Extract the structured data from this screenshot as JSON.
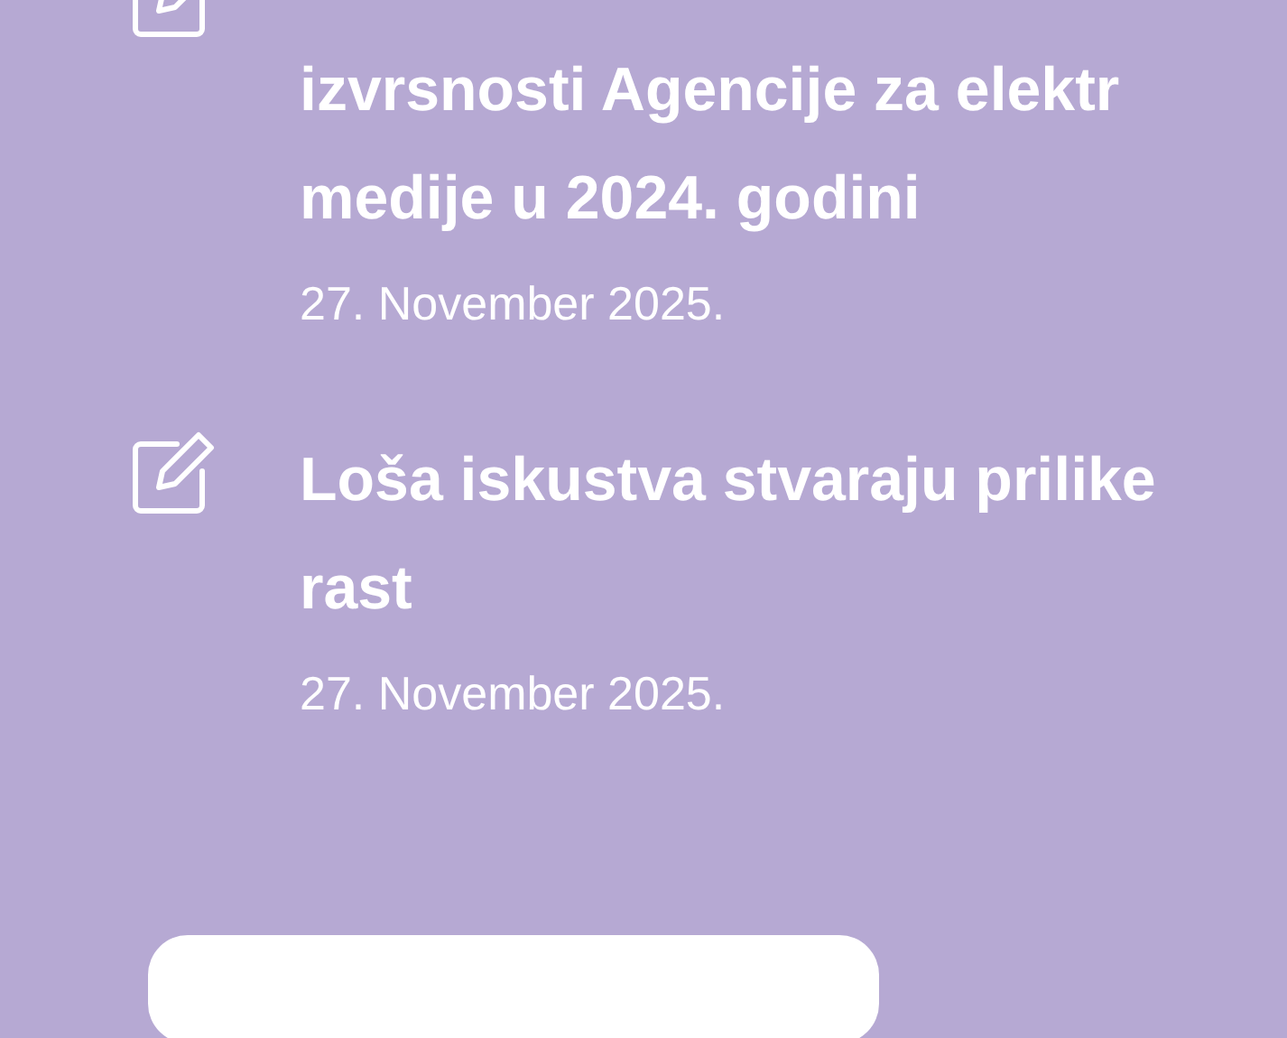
{
  "posts": [
    {
      "title_lines": [
        "izvrsnosti Agencije za elektr",
        "medije u 2024. godini"
      ],
      "date": "27. November 2025."
    },
    {
      "title_lines": [
        "Loša iskustva stvaraju prilike",
        "rast"
      ],
      "date": "27. November 2025."
    }
  ]
}
